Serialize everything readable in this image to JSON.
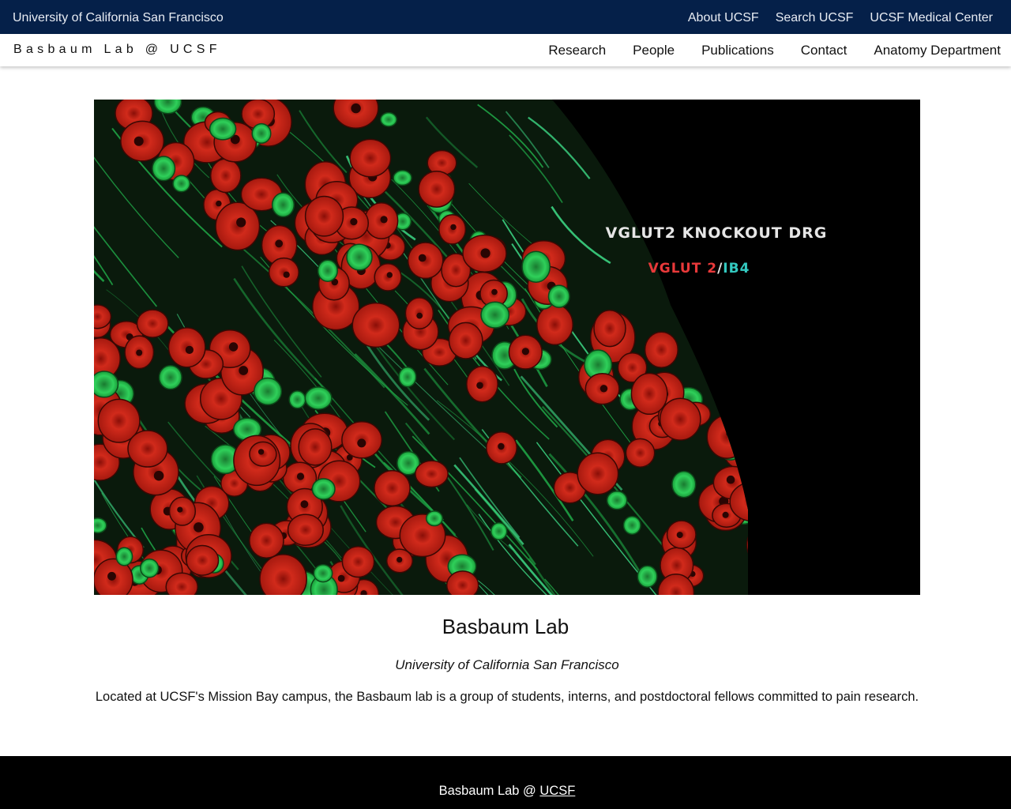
{
  "topbar": {
    "institution": "University of California San Francisco",
    "links": [
      {
        "label": "About UCSF"
      },
      {
        "label": "Search UCSF"
      },
      {
        "label": "UCSF Medical Center"
      }
    ],
    "background": "#052049"
  },
  "navbar": {
    "brand": "Basbaum Lab @ UCSF",
    "links": [
      {
        "label": "Research"
      },
      {
        "label": "People"
      },
      {
        "label": "Publications"
      },
      {
        "label": "Contact"
      },
      {
        "label": "Anatomy Department"
      }
    ]
  },
  "hero": {
    "caption_title": "VGLUT2 KNOCKOUT DRG",
    "caption_marker_red": "VGLUT 2",
    "caption_slash": "/",
    "caption_marker_cyan": "IB4",
    "colors": {
      "red_stain": "#d4241a",
      "green_stain": "#25c24a",
      "cyan_label": "#33c9c0",
      "red_label": "#e8393a"
    }
  },
  "main": {
    "title": "Basbaum Lab",
    "subtitle": "University of California San Francisco",
    "description": "Located at UCSF's Mission Bay campus, the Basbaum lab is a group of students, interns, and postdoctoral fellows committed to pain research."
  },
  "footer": {
    "text_prefix": "Basbaum Lab @ ",
    "link_label": "UCSF"
  }
}
